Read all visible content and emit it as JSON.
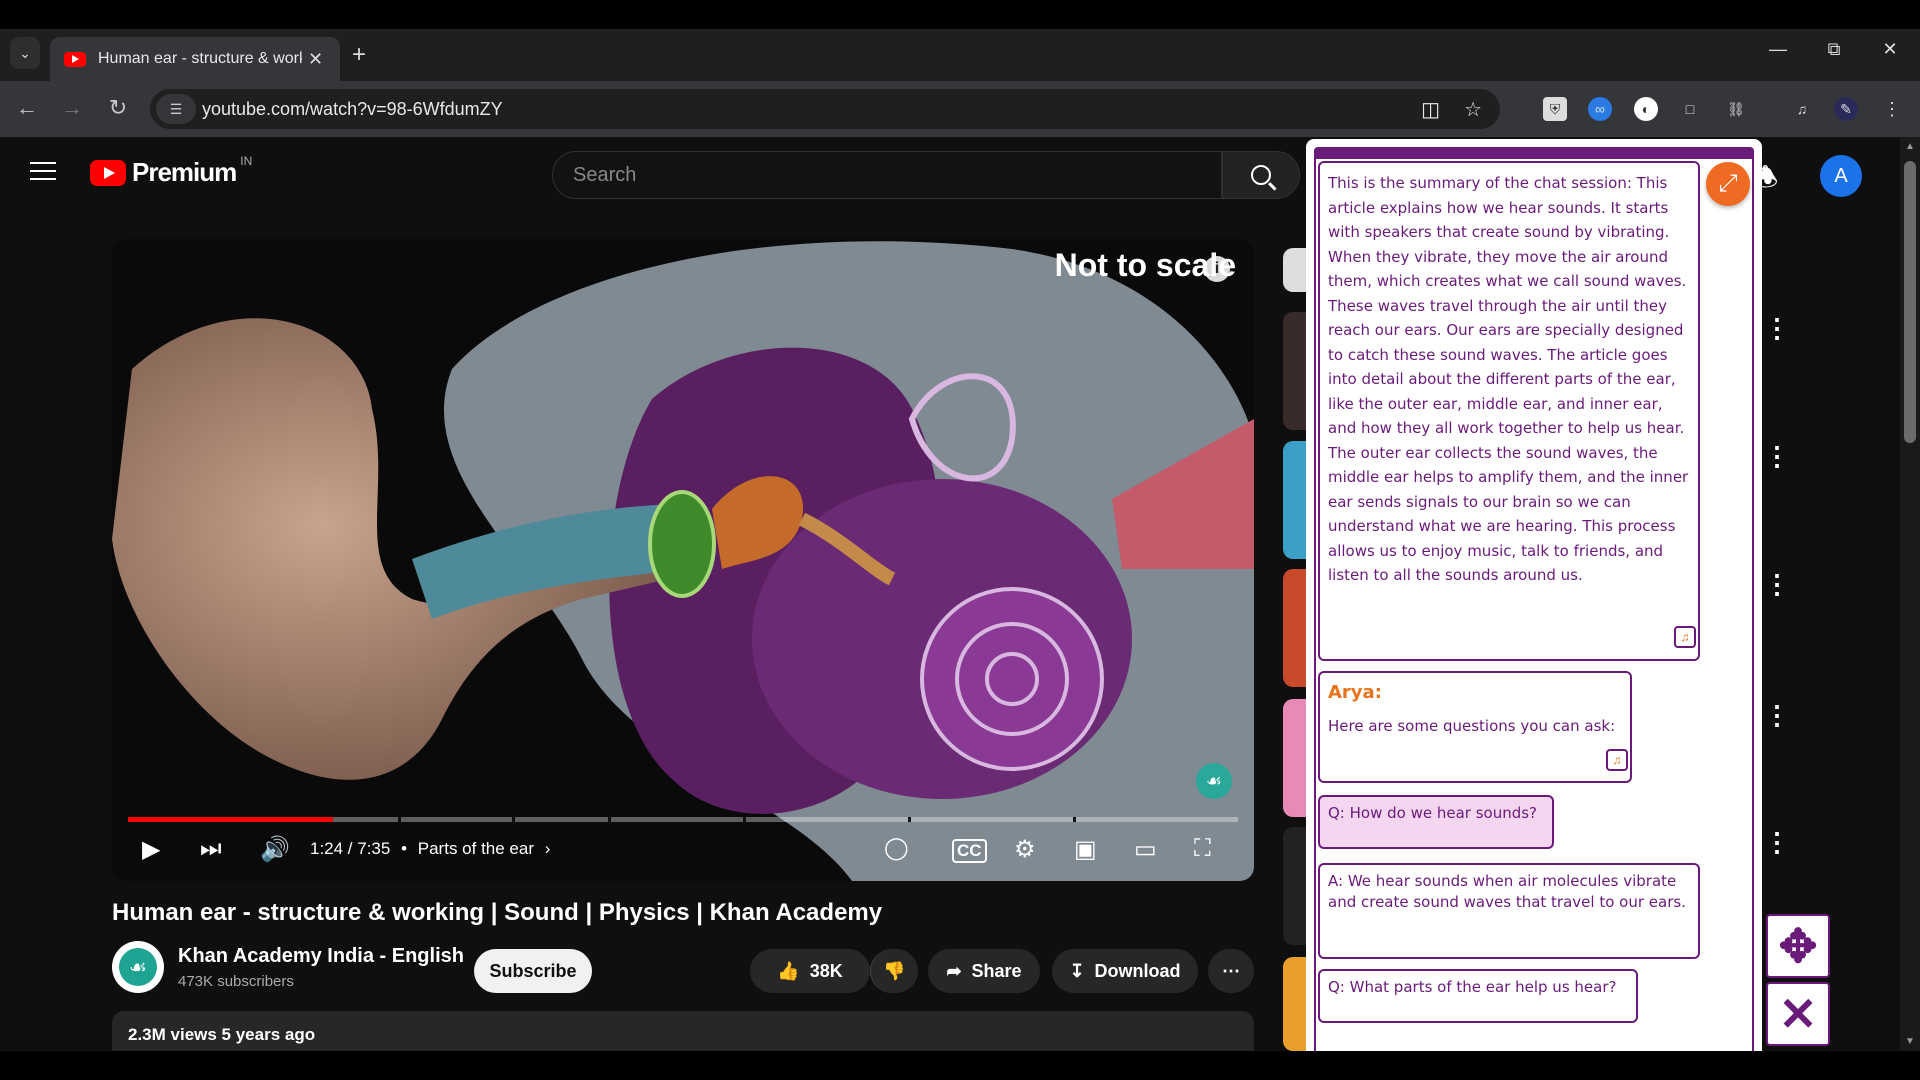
{
  "browser": {
    "tab_title": "Human ear - structure & working",
    "url": "youtube.com/watch?v=98-6WfdumZY"
  },
  "youtube": {
    "logo_text": "Premium",
    "region": "IN",
    "search_placeholder": "Search",
    "avatar_letter": "A"
  },
  "player": {
    "overlay_text": "Not to scale",
    "time": "1:24 / 7:35",
    "chapter": "Parts of the ear",
    "progress_fraction": 0.185
  },
  "video": {
    "title": "Human ear - structure & working | Sound | Physics | Khan Academy",
    "channel": "Khan Academy India - English",
    "subscribers": "473K subscribers",
    "subscribe_label": "Subscribe",
    "likes": "38K",
    "share_label": "Share",
    "download_label": "Download",
    "views": "2.3M views  5 years ago"
  },
  "chat": {
    "summary": "This is the summary of the chat session: This article explains how we hear sounds. It starts with speakers that create sound by vibrating. When they vibrate, they move the air around them, which creates what we call sound waves. These waves travel through the air until they reach our ears. Our ears are specially designed to catch these sound waves. The article goes into detail about the different parts of the ear, like the outer ear, middle ear, and inner ear, and how they all work together to help us hear. The outer ear collects the sound waves, the middle ear helps to amplify them, and the inner ear sends signals to our brain so we can understand what we are hearing. This process allows us to enjoy music, talk to friends, and listen to all the sounds around us.",
    "assistant_name": "Arya:",
    "assistant_msg": "Here are some questions you can ask:",
    "q1": "Q: How do we hear sounds?",
    "a1": "A: We hear sounds when air molecules vibrate and create sound waves that travel to our ears.",
    "q2": "Q: What parts of the ear help us hear?"
  },
  "colors": {
    "accent_purple": "#6a1b7a",
    "accent_orange": "#f06a24",
    "yt_red": "#ff0000"
  }
}
